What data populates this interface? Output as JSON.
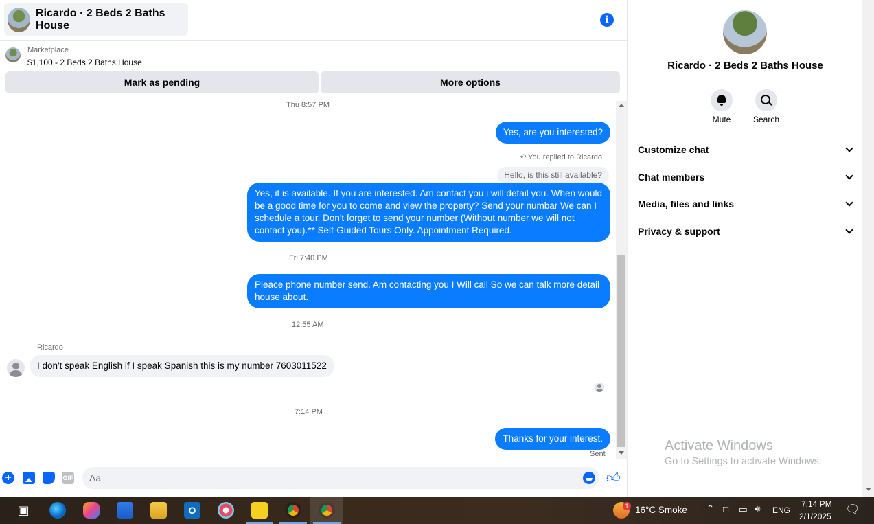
{
  "header": {
    "title": "Ricardo · 2 Beds 2 Baths House"
  },
  "marketplace": {
    "label": "Marketplace",
    "listing": "$1,100 - 2 Beds 2 Baths House",
    "pending_btn": "Mark as pending",
    "more_btn": "More options"
  },
  "messages": {
    "ts1": "Thu 8:57 PM",
    "m1": "Yes, are you interested?",
    "reply_note": "You replied to Ricardo",
    "quoted": "Hello, is this still available?",
    "m2": "Yes, it is available. If you are interested.  Am contact you i will detail you.  When would be a good time for you to come and view the property? Send your numbar We can I schedule a tour.  Don't forget to send your number (Without number we will not contact you).** Self-Guided Tours Only. Appointment Required.",
    "ts2": "Fri 7:40 PM",
    "m3": "Pleace phone number send. Am contacting you I Will call So we can talk more detail house about.",
    "ts3": "12:55 AM",
    "sender": "Ricardo",
    "m4": "I don't speak English if I speak Spanish this is my number 7603011522",
    "ts4": "7:14 PM",
    "m5": "Thanks for your interest.",
    "status": "Sent"
  },
  "composer": {
    "placeholder": "Aa",
    "gif": "GIF"
  },
  "side": {
    "title": "Ricardo · 2 Beds 2 Baths House",
    "mute": "Mute",
    "search": "Search",
    "sections": [
      "Customize chat",
      "Chat members",
      "Media, files and links",
      "Privacy & support"
    ],
    "activate_title": "Activate Windows",
    "activate_sub": "Go to Settings to activate Windows."
  },
  "taskbar": {
    "weather": "16°C  Smoke",
    "lang": "ENG",
    "time": "7:14 PM",
    "date": "2/1/2025",
    "badge": "1"
  }
}
